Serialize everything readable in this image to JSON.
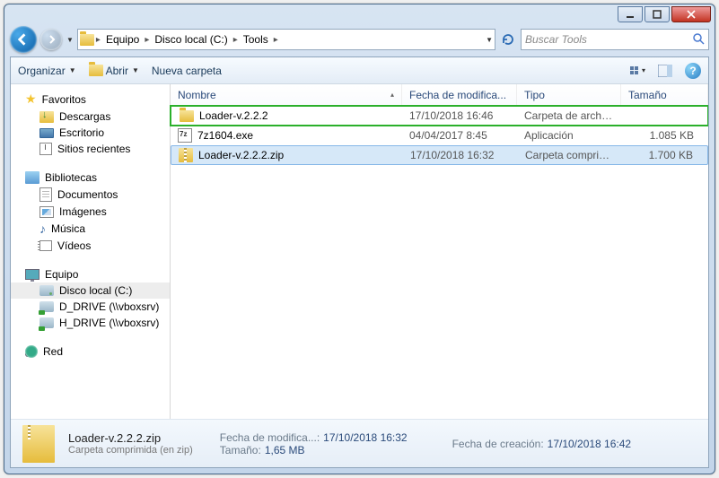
{
  "window_controls": {
    "minimize": "min",
    "maximize": "max",
    "close": "close"
  },
  "breadcrumb": {
    "items": [
      "Equipo",
      "Disco local (C:)",
      "Tools"
    ]
  },
  "search": {
    "placeholder": "Buscar Tools"
  },
  "toolbar": {
    "organize": "Organizar",
    "open": "Abrir",
    "new_folder": "Nueva carpeta"
  },
  "tree": {
    "favorites": {
      "label": "Favoritos",
      "items": [
        {
          "label": "Descargas"
        },
        {
          "label": "Escritorio"
        },
        {
          "label": "Sitios recientes"
        }
      ]
    },
    "libraries": {
      "label": "Bibliotecas",
      "items": [
        {
          "label": "Documentos"
        },
        {
          "label": "Imágenes"
        },
        {
          "label": "Música"
        },
        {
          "label": "Vídeos"
        }
      ]
    },
    "computer": {
      "label": "Equipo",
      "items": [
        {
          "label": "Disco local (C:)"
        },
        {
          "label": "D_DRIVE (\\\\vboxsrv)"
        },
        {
          "label": "H_DRIVE (\\\\vboxsrv)"
        }
      ]
    },
    "network": {
      "label": "Red"
    }
  },
  "columns": {
    "name": "Nombre",
    "date": "Fecha de modifica...",
    "type": "Tipo",
    "size": "Tamaño"
  },
  "files": [
    {
      "name": "Loader-v.2.2.2",
      "date": "17/10/2018 16:46",
      "type": "Carpeta de archivos",
      "size": "",
      "icon": "folder",
      "highlight": true,
      "selected": false
    },
    {
      "name": "7z1604.exe",
      "date": "04/04/2017 8:45",
      "type": "Aplicación",
      "size": "1.085 KB",
      "icon": "exe",
      "highlight": false,
      "selected": false
    },
    {
      "name": "Loader-v.2.2.2.zip",
      "date": "17/10/2018 16:32",
      "type": "Carpeta comprimi...",
      "size": "1.700 KB",
      "icon": "zip",
      "highlight": false,
      "selected": true
    }
  ],
  "details": {
    "filename": "Loader-v.2.2.2.zip",
    "filetype": "Carpeta comprimida (en zip)",
    "mod_label": "Fecha de modifica...:",
    "mod_value": "17/10/2018 16:32",
    "size_label": "Tamaño:",
    "size_value": "1,65 MB",
    "created_label": "Fecha de creación:",
    "created_value": "17/10/2018 16:42"
  }
}
